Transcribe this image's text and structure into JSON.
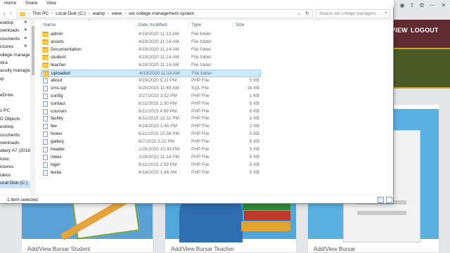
{
  "website": {
    "nav": [
      "VIEW",
      "LOGOUT"
    ],
    "cards": [
      "Add/View Bursar Student",
      "Add/View Bursar Teacher",
      "Add/View Bursar"
    ]
  },
  "explorer": {
    "ribbon_tabs": [
      "Home",
      "Share",
      "View"
    ],
    "breadcrumbs": [
      "This PC",
      "Local Disk (C:)",
      "wamp",
      "www",
      "iub college management system"
    ],
    "search_placeholder": "Search iub college managem...",
    "columns": {
      "name": "Name",
      "date": "Date modified",
      "type": "Type",
      "size": "Size"
    },
    "sidebar": [
      {
        "label": "esktop",
        "pinned": true
      },
      {
        "label": "ownloads",
        "pinned": true
      },
      {
        "label": "ocuments",
        "pinned": true
      },
      {
        "label": "ictures",
        "pinned": true
      },
      {
        "label": "ollege managem",
        "pinned": false
      },
      {
        "label": "xtra",
        "pinned": false
      },
      {
        "label": "aculty managem",
        "pinned": false
      },
      {
        "label": "ql",
        "pinned": false
      },
      {
        "label": "",
        "pinned": false
      },
      {
        "label": "eDrive",
        "pinned": false
      },
      {
        "label": "",
        "pinned": false
      },
      {
        "label": "s PC",
        "pinned": false
      },
      {
        "label": "D Objects",
        "pinned": false
      },
      {
        "label": "esktop",
        "pinned": false
      },
      {
        "label": "ocuments",
        "pinned": false
      },
      {
        "label": "ownloads",
        "pinned": false
      },
      {
        "label": "alaxy A7 (2018)",
        "pinned": false
      },
      {
        "label": "lusic",
        "pinned": false
      },
      {
        "label": "ictures",
        "pinned": false
      },
      {
        "label": "ideos",
        "pinned": false
      },
      {
        "label": "ocal Disk (C:)",
        "pinned": false,
        "selected": true
      }
    ],
    "files": [
      {
        "name": "admin",
        "date": "4/19/2020 11:13 AM",
        "type": "File folder",
        "size": "",
        "kind": "folder"
      },
      {
        "name": "assets",
        "date": "4/19/2020 11:14 AM",
        "type": "File folder",
        "size": "",
        "kind": "folder"
      },
      {
        "name": "Documentation",
        "date": "4/19/2020 11:14 AM",
        "type": "File folder",
        "size": "",
        "kind": "folder"
      },
      {
        "name": "student",
        "date": "4/19/2020 11:14 AM",
        "type": "File folder",
        "size": "",
        "kind": "folder"
      },
      {
        "name": "teacher",
        "date": "4/19/2020 11:14 AM",
        "type": "File folder",
        "size": "",
        "kind": "folder"
      },
      {
        "name": "uploaded",
        "date": "4/19/2020 11:14 AM",
        "type": "File folder",
        "size": "",
        "kind": "folder",
        "selected": true
      },
      {
        "name": "about",
        "date": "4/19/2020 5:11 PM",
        "type": "PHP File",
        "size": "5 KB",
        "kind": "file"
      },
      {
        "name": "cms.sql",
        "date": "8/20/2015 11:49 AM",
        "type": "SQL File",
        "size": "16 KB",
        "kind": "file"
      },
      {
        "name": "config",
        "date": "3/27/2015 3:52 PM",
        "type": "PHP File",
        "size": "1 KB",
        "kind": "file"
      },
      {
        "name": "contact",
        "date": "8/11/2015 1:30 PM",
        "type": "PHP File",
        "size": "5 KB",
        "kind": "file"
      },
      {
        "name": "courses",
        "date": "8/11/2015 4:59 PM",
        "type": "PHP File",
        "size": "8 KB",
        "kind": "file"
      },
      {
        "name": "facility",
        "date": "8/11/2015 12:32 PM",
        "type": "PHP File",
        "size": "2 KB",
        "kind": "file"
      },
      {
        "name": "fee",
        "date": "4/24/2015 1:45 PM",
        "type": "PHP File",
        "size": "2 KB",
        "kind": "file"
      },
      {
        "name": "footer",
        "date": "8/11/2015 12:38 PM",
        "type": "PHP File",
        "size": "5 KB",
        "kind": "file"
      },
      {
        "name": "gallery",
        "date": "8/7/2015 5:22 PM",
        "type": "PHP File",
        "size": "6 KB",
        "kind": "file"
      },
      {
        "name": "header",
        "date": "2/26/2020 10:43 PM",
        "type": "PHP File",
        "size": "5 KB",
        "kind": "file"
      },
      {
        "name": "index",
        "date": "2/26/2020 11:14 PM",
        "type": "PHP File",
        "size": "5 KB",
        "kind": "file"
      },
      {
        "name": "login",
        "date": "8/11/2015 2:59 PM",
        "type": "PHP File",
        "size": "5 KB",
        "kind": "file"
      },
      {
        "name": "texila",
        "date": "8/14/2015 1:46 AM",
        "type": "PHP File",
        "size": "5 KB",
        "kind": "file"
      }
    ],
    "status": "1 item selected"
  },
  "colors": {
    "folder": "#f6c94e",
    "selection": "#cce8ff",
    "nav_bar": "#5f2c31",
    "card_image": "#5aa2d6"
  }
}
